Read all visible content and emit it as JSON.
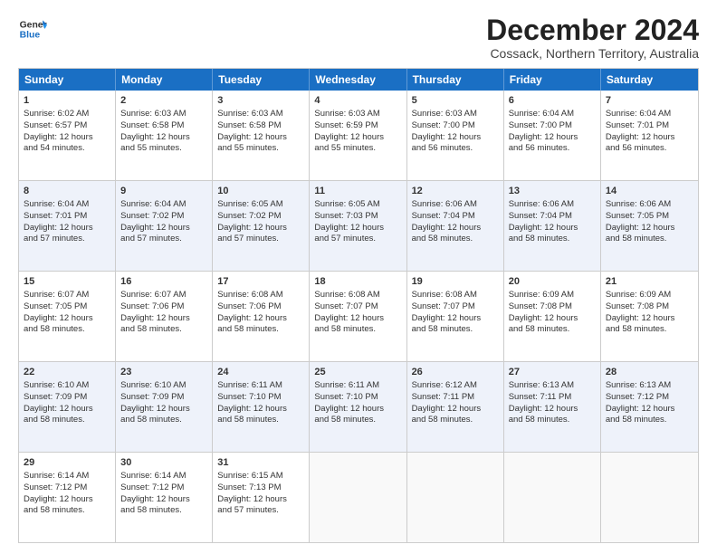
{
  "header": {
    "logo_line1": "General",
    "logo_line2": "Blue",
    "title": "December 2024",
    "subtitle": "Cossack, Northern Territory, Australia"
  },
  "calendar": {
    "days": [
      "Sunday",
      "Monday",
      "Tuesday",
      "Wednesday",
      "Thursday",
      "Friday",
      "Saturday"
    ],
    "rows": [
      [
        {
          "num": "1",
          "text": "Sunrise: 6:02 AM\nSunset: 6:57 PM\nDaylight: 12 hours\nand 54 minutes."
        },
        {
          "num": "2",
          "text": "Sunrise: 6:03 AM\nSunset: 6:58 PM\nDaylight: 12 hours\nand 55 minutes."
        },
        {
          "num": "3",
          "text": "Sunrise: 6:03 AM\nSunset: 6:58 PM\nDaylight: 12 hours\nand 55 minutes."
        },
        {
          "num": "4",
          "text": "Sunrise: 6:03 AM\nSunset: 6:59 PM\nDaylight: 12 hours\nand 55 minutes."
        },
        {
          "num": "5",
          "text": "Sunrise: 6:03 AM\nSunset: 7:00 PM\nDaylight: 12 hours\nand 56 minutes."
        },
        {
          "num": "6",
          "text": "Sunrise: 6:04 AM\nSunset: 7:00 PM\nDaylight: 12 hours\nand 56 minutes."
        },
        {
          "num": "7",
          "text": "Sunrise: 6:04 AM\nSunset: 7:01 PM\nDaylight: 12 hours\nand 56 minutes."
        }
      ],
      [
        {
          "num": "8",
          "text": "Sunrise: 6:04 AM\nSunset: 7:01 PM\nDaylight: 12 hours\nand 57 minutes."
        },
        {
          "num": "9",
          "text": "Sunrise: 6:04 AM\nSunset: 7:02 PM\nDaylight: 12 hours\nand 57 minutes."
        },
        {
          "num": "10",
          "text": "Sunrise: 6:05 AM\nSunset: 7:02 PM\nDaylight: 12 hours\nand 57 minutes."
        },
        {
          "num": "11",
          "text": "Sunrise: 6:05 AM\nSunset: 7:03 PM\nDaylight: 12 hours\nand 57 minutes."
        },
        {
          "num": "12",
          "text": "Sunrise: 6:06 AM\nSunset: 7:04 PM\nDaylight: 12 hours\nand 58 minutes."
        },
        {
          "num": "13",
          "text": "Sunrise: 6:06 AM\nSunset: 7:04 PM\nDaylight: 12 hours\nand 58 minutes."
        },
        {
          "num": "14",
          "text": "Sunrise: 6:06 AM\nSunset: 7:05 PM\nDaylight: 12 hours\nand 58 minutes."
        }
      ],
      [
        {
          "num": "15",
          "text": "Sunrise: 6:07 AM\nSunset: 7:05 PM\nDaylight: 12 hours\nand 58 minutes."
        },
        {
          "num": "16",
          "text": "Sunrise: 6:07 AM\nSunset: 7:06 PM\nDaylight: 12 hours\nand 58 minutes."
        },
        {
          "num": "17",
          "text": "Sunrise: 6:08 AM\nSunset: 7:06 PM\nDaylight: 12 hours\nand 58 minutes."
        },
        {
          "num": "18",
          "text": "Sunrise: 6:08 AM\nSunset: 7:07 PM\nDaylight: 12 hours\nand 58 minutes."
        },
        {
          "num": "19",
          "text": "Sunrise: 6:08 AM\nSunset: 7:07 PM\nDaylight: 12 hours\nand 58 minutes."
        },
        {
          "num": "20",
          "text": "Sunrise: 6:09 AM\nSunset: 7:08 PM\nDaylight: 12 hours\nand 58 minutes."
        },
        {
          "num": "21",
          "text": "Sunrise: 6:09 AM\nSunset: 7:08 PM\nDaylight: 12 hours\nand 58 minutes."
        }
      ],
      [
        {
          "num": "22",
          "text": "Sunrise: 6:10 AM\nSunset: 7:09 PM\nDaylight: 12 hours\nand 58 minutes."
        },
        {
          "num": "23",
          "text": "Sunrise: 6:10 AM\nSunset: 7:09 PM\nDaylight: 12 hours\nand 58 minutes."
        },
        {
          "num": "24",
          "text": "Sunrise: 6:11 AM\nSunset: 7:10 PM\nDaylight: 12 hours\nand 58 minutes."
        },
        {
          "num": "25",
          "text": "Sunrise: 6:11 AM\nSunset: 7:10 PM\nDaylight: 12 hours\nand 58 minutes."
        },
        {
          "num": "26",
          "text": "Sunrise: 6:12 AM\nSunset: 7:11 PM\nDaylight: 12 hours\nand 58 minutes."
        },
        {
          "num": "27",
          "text": "Sunrise: 6:13 AM\nSunset: 7:11 PM\nDaylight: 12 hours\nand 58 minutes."
        },
        {
          "num": "28",
          "text": "Sunrise: 6:13 AM\nSunset: 7:12 PM\nDaylight: 12 hours\nand 58 minutes."
        }
      ],
      [
        {
          "num": "29",
          "text": "Sunrise: 6:14 AM\nSunset: 7:12 PM\nDaylight: 12 hours\nand 58 minutes."
        },
        {
          "num": "30",
          "text": "Sunrise: 6:14 AM\nSunset: 7:12 PM\nDaylight: 12 hours\nand 58 minutes."
        },
        {
          "num": "31",
          "text": "Sunrise: 6:15 AM\nSunset: 7:13 PM\nDaylight: 12 hours\nand 57 minutes."
        },
        {
          "num": "",
          "text": ""
        },
        {
          "num": "",
          "text": ""
        },
        {
          "num": "",
          "text": ""
        },
        {
          "num": "",
          "text": ""
        }
      ]
    ]
  }
}
